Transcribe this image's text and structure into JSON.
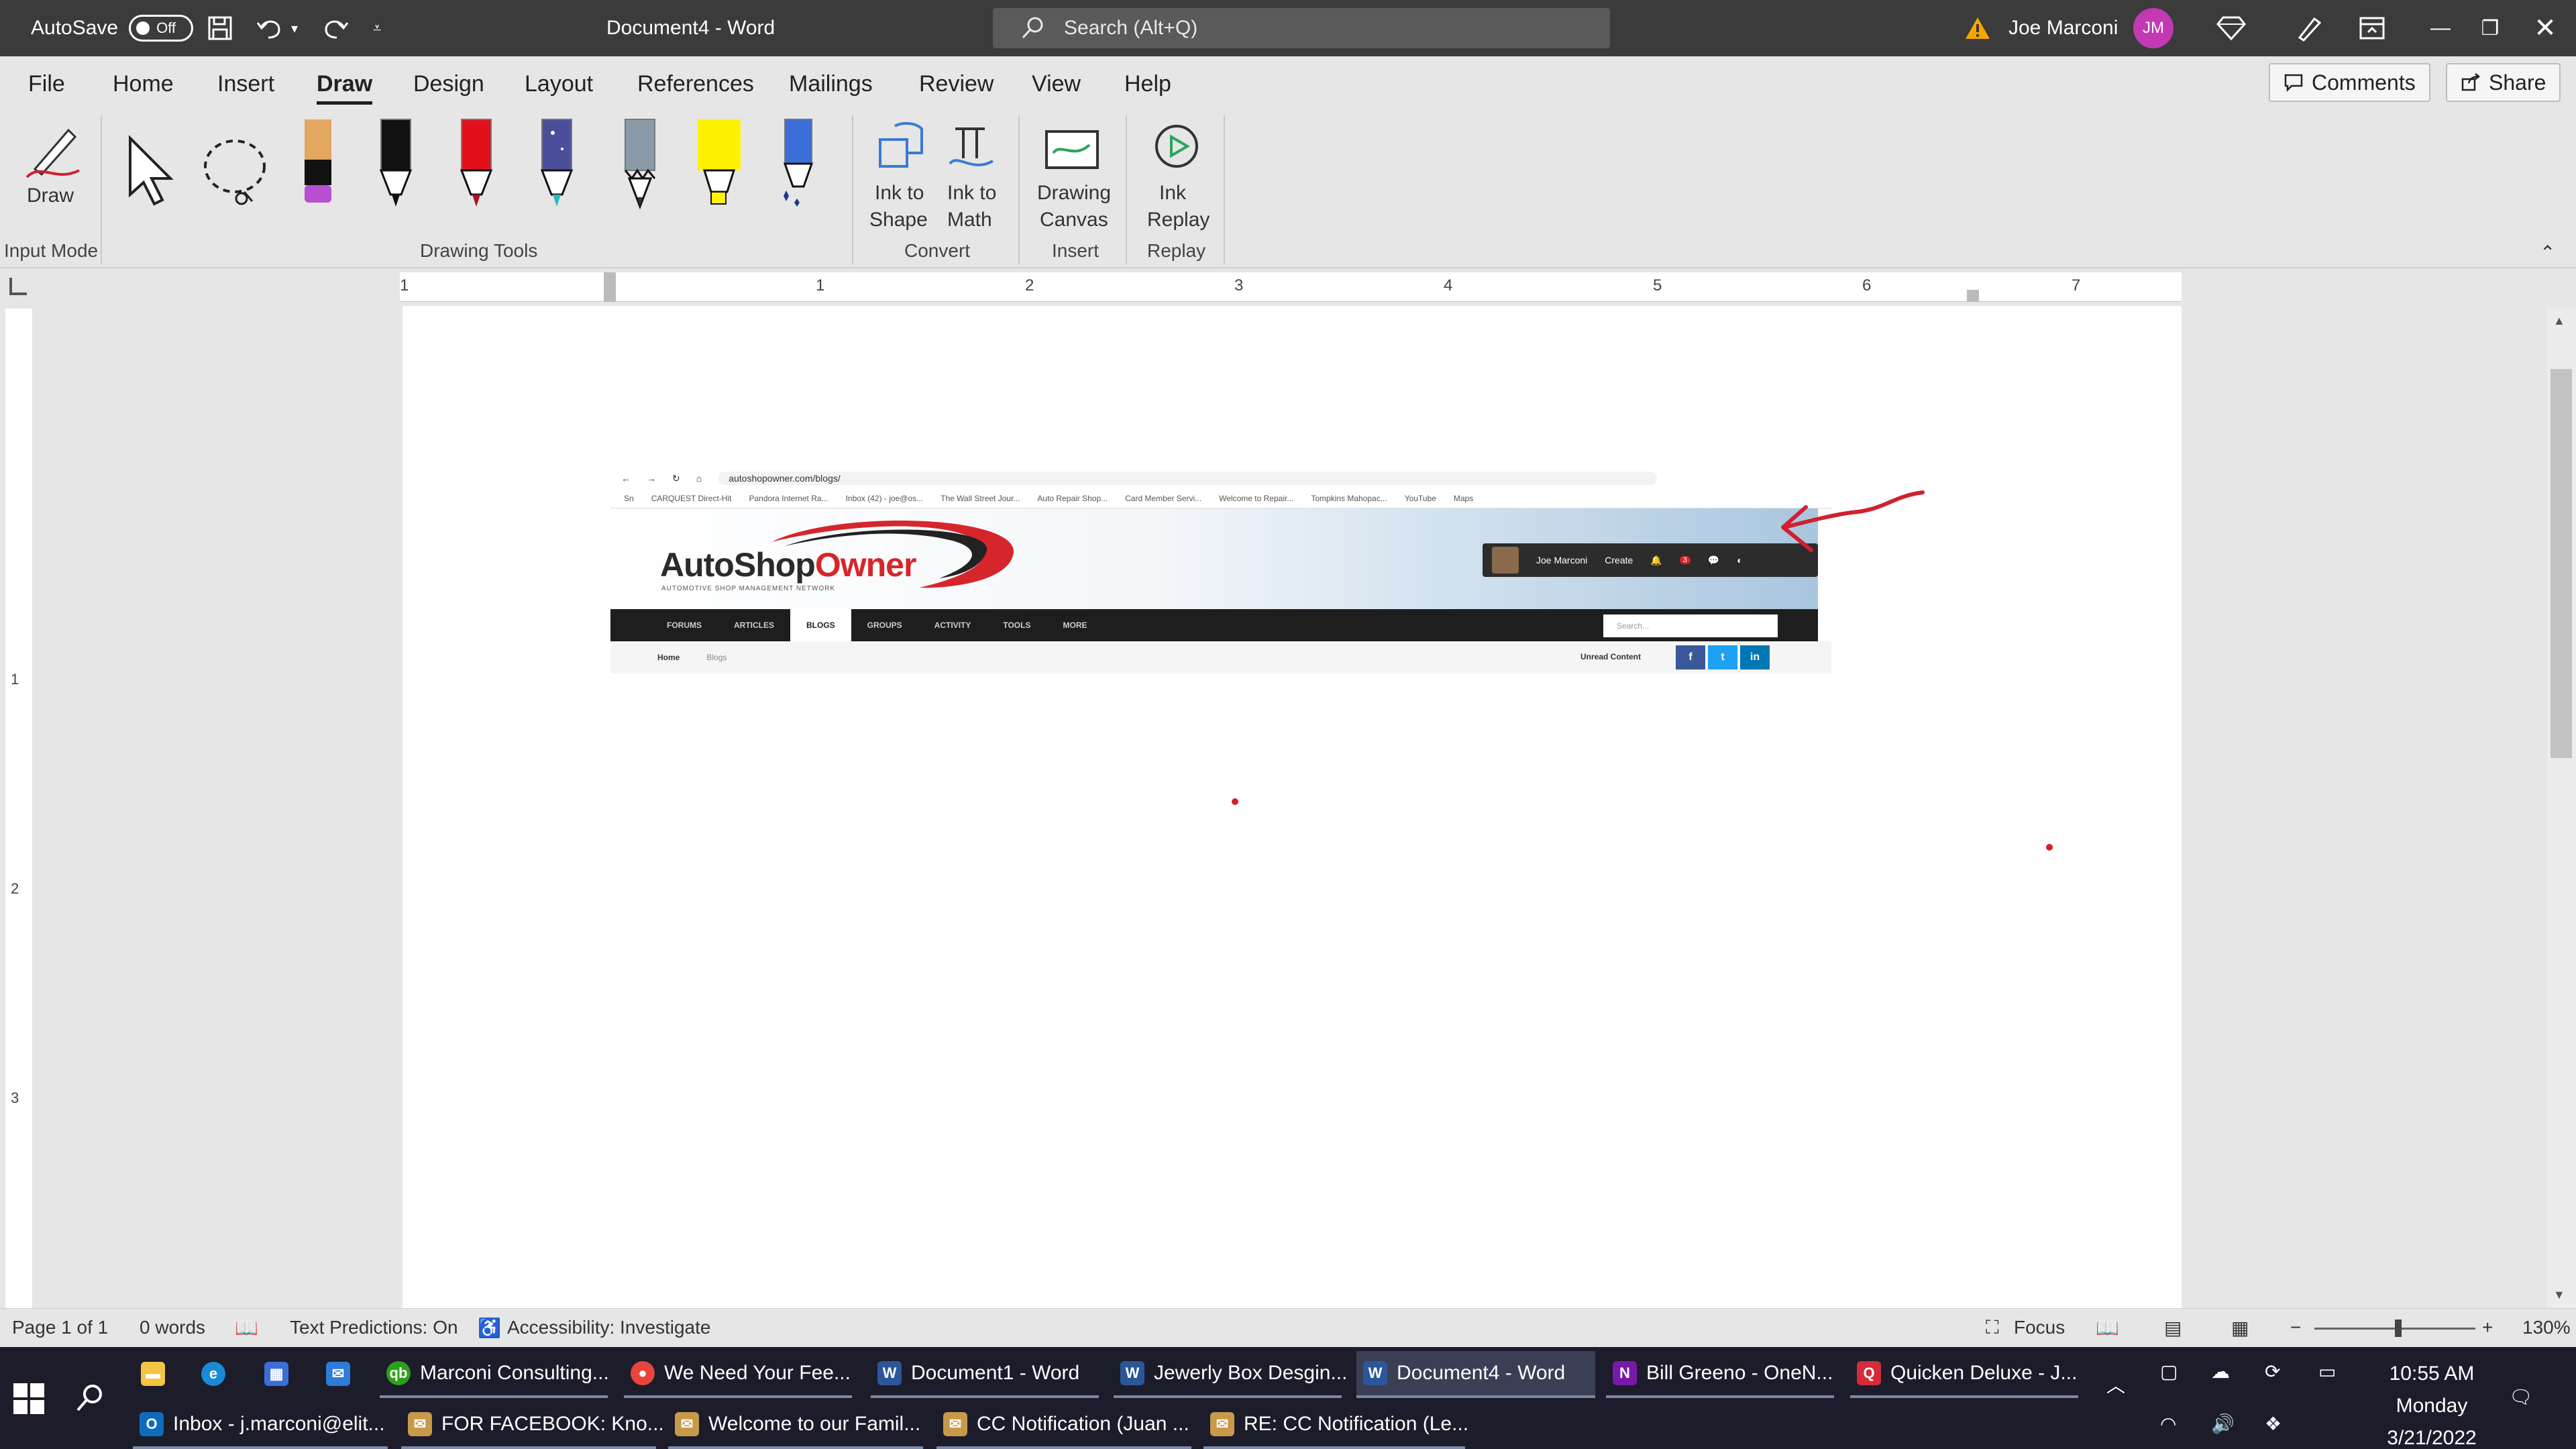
{
  "titlebar": {
    "autosave_label": "AutoSave",
    "autosave_state": "Off",
    "doc_title": "Document4 - Word",
    "search_placeholder": "Search (Alt+Q)",
    "user_name": "Joe Marconi",
    "user_initials": "JM"
  },
  "tabs": [
    "File",
    "Home",
    "Insert",
    "Draw",
    "Design",
    "Layout",
    "References",
    "Mailings",
    "Review",
    "View",
    "Help"
  ],
  "active_tab": "Draw",
  "top_buttons": {
    "comments": "Comments",
    "share": "Share"
  },
  "ribbon": {
    "draw_label": "Draw",
    "input_mode_label": "Input Mode",
    "drawing_tools_label": "Drawing Tools",
    "ink_to_shape": [
      "Ink to",
      "Shape"
    ],
    "ink_to_math": [
      "Ink to",
      "Math"
    ],
    "convert_label": "Convert",
    "drawing_canvas": [
      "Drawing",
      "Canvas"
    ],
    "insert_label": "Insert",
    "ink_replay": [
      "Ink",
      "Replay"
    ],
    "replay_label": "Replay"
  },
  "ruler": {
    "h_numbers": [
      "1",
      "1",
      "2",
      "3",
      "4",
      "5",
      "6",
      "7"
    ],
    "v_numbers": [
      "1",
      "2",
      "3"
    ]
  },
  "embedded_screenshot": {
    "url": "autoshopowner.com/blogs/",
    "bookmarks": [
      "Sn",
      "CARQUEST Direct-Hit",
      "Pandora Internet Ra...",
      "Inbox (42) - joe@os...",
      "The Wall Street Jour...",
      "Auto Repair Shop...",
      "Card Member Servi...",
      "Welcome to Repair...",
      "Tompkins Mahopac...",
      "YouTube",
      "Maps"
    ],
    "logo_dark": "AutoShop",
    "logo_red": "Owner",
    "logo_sub": "AUTOMOTIVE SHOP MANAGEMENT NETWORK",
    "user": "Joe Marconi",
    "create": "Create",
    "nav": [
      "FORUMS",
      "ARTICLES",
      "BLOGS",
      "GROUPS",
      "ACTIVITY",
      "TOOLS",
      "MORE"
    ],
    "nav_active": "BLOGS",
    "nav_search": "Search...",
    "crumb_home": "Home",
    "crumb_blogs": "Blogs",
    "unread": "Unread Content",
    "social": [
      "f",
      "t",
      "in"
    ],
    "notif_count": "3"
  },
  "statusbar": {
    "page": "Page 1 of 1",
    "words": "0 words",
    "text_predictions": "Text Predictions: On",
    "accessibility": "Accessibility: Investigate",
    "focus": "Focus",
    "zoom": "130%"
  },
  "taskbar": {
    "row1": [
      {
        "label": "Marconi Consulting...",
        "icon": "qb",
        "color": "#2ca01c"
      },
      {
        "label": "We Need Your Fee...",
        "icon": "chrome",
        "color": "#e8453c"
      },
      {
        "label": "Document1 - Word",
        "icon": "W",
        "color": "#2b579a"
      },
      {
        "label": "Jewerly Box Desgin...",
        "icon": "W",
        "color": "#2b579a"
      },
      {
        "label": "Document4 - Word",
        "icon": "W",
        "color": "#2b579a"
      },
      {
        "label": "Bill Greeno - OneN...",
        "icon": "N",
        "color": "#7719aa"
      },
      {
        "label": "Quicken Deluxe - J...",
        "icon": "Q",
        "color": "#d52b3a"
      }
    ],
    "row2": [
      {
        "label": "Inbox - j.marconi@elit...",
        "icon": "O",
        "color": "#0f6cbd"
      },
      {
        "label": "FOR FACEBOOK: Kno...",
        "icon": "✉",
        "color": "#c79a4a"
      },
      {
        "label": "Welcome to our Famil...",
        "icon": "✉",
        "color": "#c79a4a"
      },
      {
        "label": "CC Notification (Juan ...",
        "icon": "✉",
        "color": "#c79a4a"
      },
      {
        "label": "RE: CC Notification (Le...",
        "icon": "✉",
        "color": "#c79a4a"
      }
    ],
    "time": "10:55 AM",
    "day": "Monday",
    "date": "3/21/2022"
  },
  "colors": {
    "titlebar": "#3b3b3b",
    "ribbon": "#e6e6e6",
    "accent_word": "#2b579a",
    "ink_red": "#d0202f",
    "taskbar": "#1c1c2b"
  }
}
